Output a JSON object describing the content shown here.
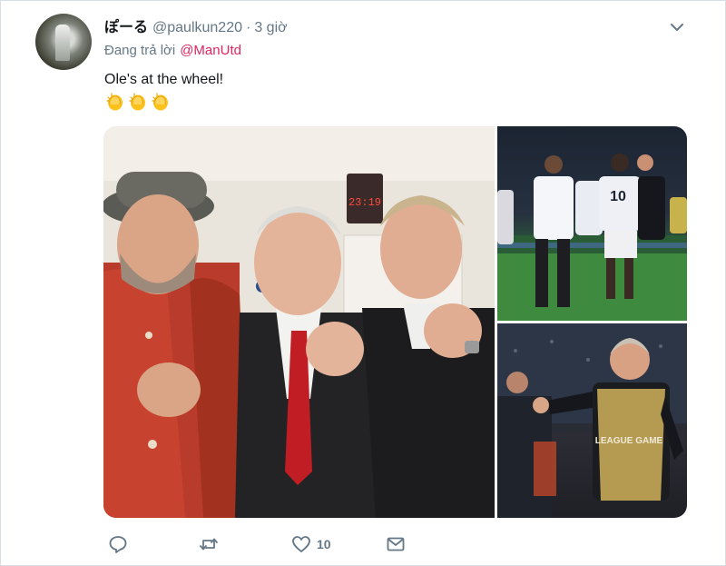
{
  "tweet": {
    "display_name": "ぽーる",
    "handle": "@paulkun220",
    "separator": "·",
    "time": "3 giờ",
    "reply_prefix": "Đang trả lời",
    "reply_mention": "@ManUtd",
    "text": "Ole's at the wheel!",
    "emoji": [
      "clapping-hands",
      "clapping-hands",
      "clapping-hands"
    ]
  },
  "media": {
    "photos": [
      {
        "name": "photo-locker-room"
      },
      {
        "name": "photo-celebration-pitch"
      },
      {
        "name": "photo-coach-touchline"
      }
    ],
    "clock_text": "23:19",
    "bib_text": "LEAGUE GAME"
  },
  "actions": {
    "reply_icon": "reply-icon",
    "retweet_icon": "retweet-icon",
    "like_icon": "heart-icon",
    "like_count": "10",
    "message_icon": "envelope-icon"
  },
  "colors": {
    "mention": "#e0245e",
    "secondary_text": "#657786",
    "primary_text": "#14171a",
    "background": "#ffffff"
  }
}
